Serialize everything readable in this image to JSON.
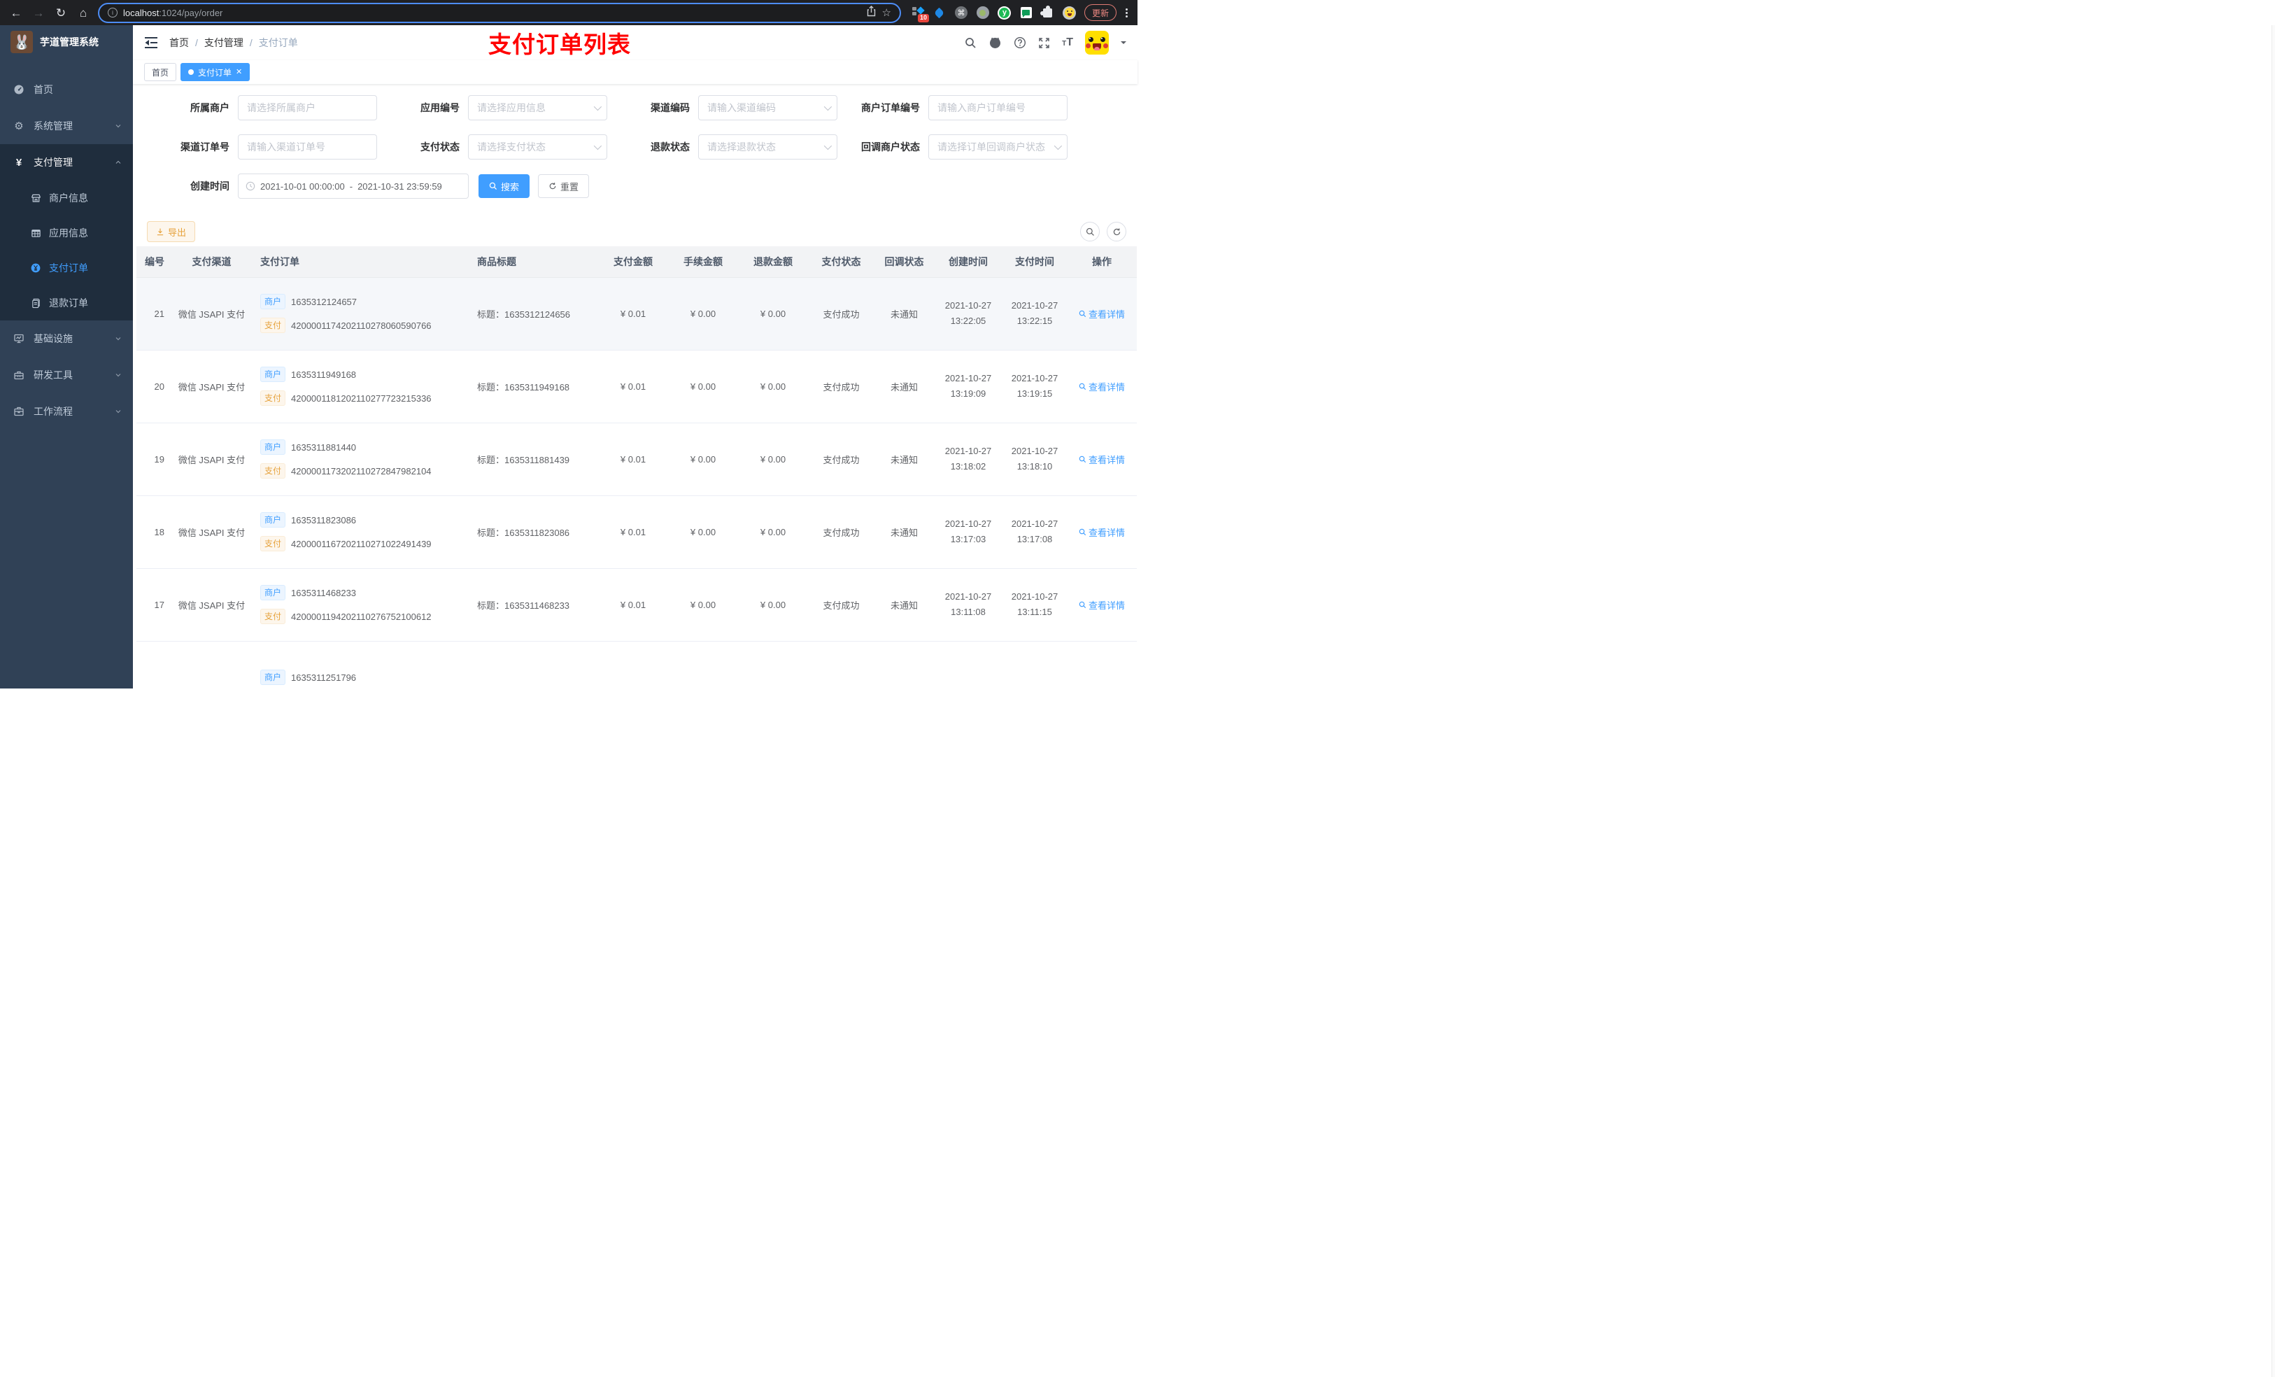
{
  "colors": {
    "accent": "#409eff",
    "sidebar_bg": "#304156",
    "submenu_bg": "#1f2d3d",
    "annotation_red": "#ff0000",
    "warning": "#e6a23c"
  },
  "browser": {
    "url_host": "localhost",
    "url_path": ":1024/pay/order",
    "extension_badge": "10",
    "update_label": "更新"
  },
  "sidebar": {
    "title": "芋道管理系统",
    "menu": [
      {
        "label": "首页"
      },
      {
        "label": "系统管理"
      },
      {
        "label": "支付管理",
        "children": [
          {
            "label": "商户信息"
          },
          {
            "label": "应用信息"
          },
          {
            "label": "支付订单"
          },
          {
            "label": "退款订单"
          }
        ]
      },
      {
        "label": "基础设施"
      },
      {
        "label": "研发工具"
      },
      {
        "label": "工作流程"
      }
    ]
  },
  "topbar": {
    "breadcrumb": [
      "首页",
      "支付管理",
      "支付订单"
    ],
    "separator": "/",
    "annotation": "支付订单列表"
  },
  "tabs": [
    {
      "label": "首页"
    },
    {
      "label": "支付订单"
    }
  ],
  "filters": {
    "fields": [
      {
        "label": "所属商户",
        "placeholder": "请选择所属商户"
      },
      {
        "label": "应用编号",
        "placeholder": "请选择应用信息"
      },
      {
        "label": "渠道编码",
        "placeholder": "请输入渠道编码"
      },
      {
        "label": "商户订单编号",
        "placeholder": "请输入商户订单编号"
      },
      {
        "label": "渠道订单号",
        "placeholder": "请输入渠道订单号"
      },
      {
        "label": "支付状态",
        "placeholder": "请选择支付状态"
      },
      {
        "label": "退款状态",
        "placeholder": "请选择退款状态"
      },
      {
        "label": "回调商户状态",
        "placeholder": "请选择订单回调商户状态"
      }
    ],
    "date": {
      "label": "创建时间",
      "start": "2021-10-01 00:00:00",
      "separator": "-",
      "end": "2021-10-31 23:59:59"
    },
    "search_label": "搜索",
    "reset_label": "重置"
  },
  "toolbar": {
    "export_label": "导出"
  },
  "table": {
    "headers": [
      "编号",
      "支付渠道",
      "支付订单",
      "商品标题",
      "支付金额",
      "手续金额",
      "退款金额",
      "支付状态",
      "回调状态",
      "创建时间",
      "支付时间",
      "操作"
    ],
    "merchant_tag": "商户",
    "pay_tag": "支付",
    "title_prefix": "标题：",
    "view_label": "查看详情",
    "rows": [
      {
        "id": "21",
        "channel": "微信 JSAPI 支付",
        "merchant_no": "1635312124657",
        "pay_no": "4200001174202110278060590766",
        "title": "1635312124656",
        "amount": "¥ 0.01",
        "fee": "¥ 0.00",
        "refund": "¥ 0.00",
        "status": "支付成功",
        "notify": "未通知",
        "create_date": "2021-10-27",
        "create_time": "13:22:05",
        "pay_date": "2021-10-27",
        "pay_time": "13:22:15"
      },
      {
        "id": "20",
        "channel": "微信 JSAPI 支付",
        "merchant_no": "1635311949168",
        "pay_no": "4200001181202110277723215336",
        "title": "1635311949168",
        "amount": "¥ 0.01",
        "fee": "¥ 0.00",
        "refund": "¥ 0.00",
        "status": "支付成功",
        "notify": "未通知",
        "create_date": "2021-10-27",
        "create_time": "13:19:09",
        "pay_date": "2021-10-27",
        "pay_time": "13:19:15"
      },
      {
        "id": "19",
        "channel": "微信 JSAPI 支付",
        "merchant_no": "1635311881440",
        "pay_no": "4200001173202110272847982104",
        "title": "1635311881439",
        "amount": "¥ 0.01",
        "fee": "¥ 0.00",
        "refund": "¥ 0.00",
        "status": "支付成功",
        "notify": "未通知",
        "create_date": "2021-10-27",
        "create_time": "13:18:02",
        "pay_date": "2021-10-27",
        "pay_time": "13:18:10"
      },
      {
        "id": "18",
        "channel": "微信 JSAPI 支付",
        "merchant_no": "1635311823086",
        "pay_no": "4200001167202110271022491439",
        "title": "1635311823086",
        "amount": "¥ 0.01",
        "fee": "¥ 0.00",
        "refund": "¥ 0.00",
        "status": "支付成功",
        "notify": "未通知",
        "create_date": "2021-10-27",
        "create_time": "13:17:03",
        "pay_date": "2021-10-27",
        "pay_time": "13:17:08"
      },
      {
        "id": "17",
        "channel": "微信 JSAPI 支付",
        "merchant_no": "1635311468233",
        "pay_no": "4200001194202110276752100612",
        "title": "1635311468233",
        "amount": "¥ 0.01",
        "fee": "¥ 0.00",
        "refund": "¥ 0.00",
        "status": "支付成功",
        "notify": "未通知",
        "create_date": "2021-10-27",
        "create_time": "13:11:08",
        "pay_date": "2021-10-27",
        "pay_time": "13:11:15"
      },
      {
        "id": "",
        "channel": "",
        "merchant_no": "1635311251796"
      }
    ]
  }
}
